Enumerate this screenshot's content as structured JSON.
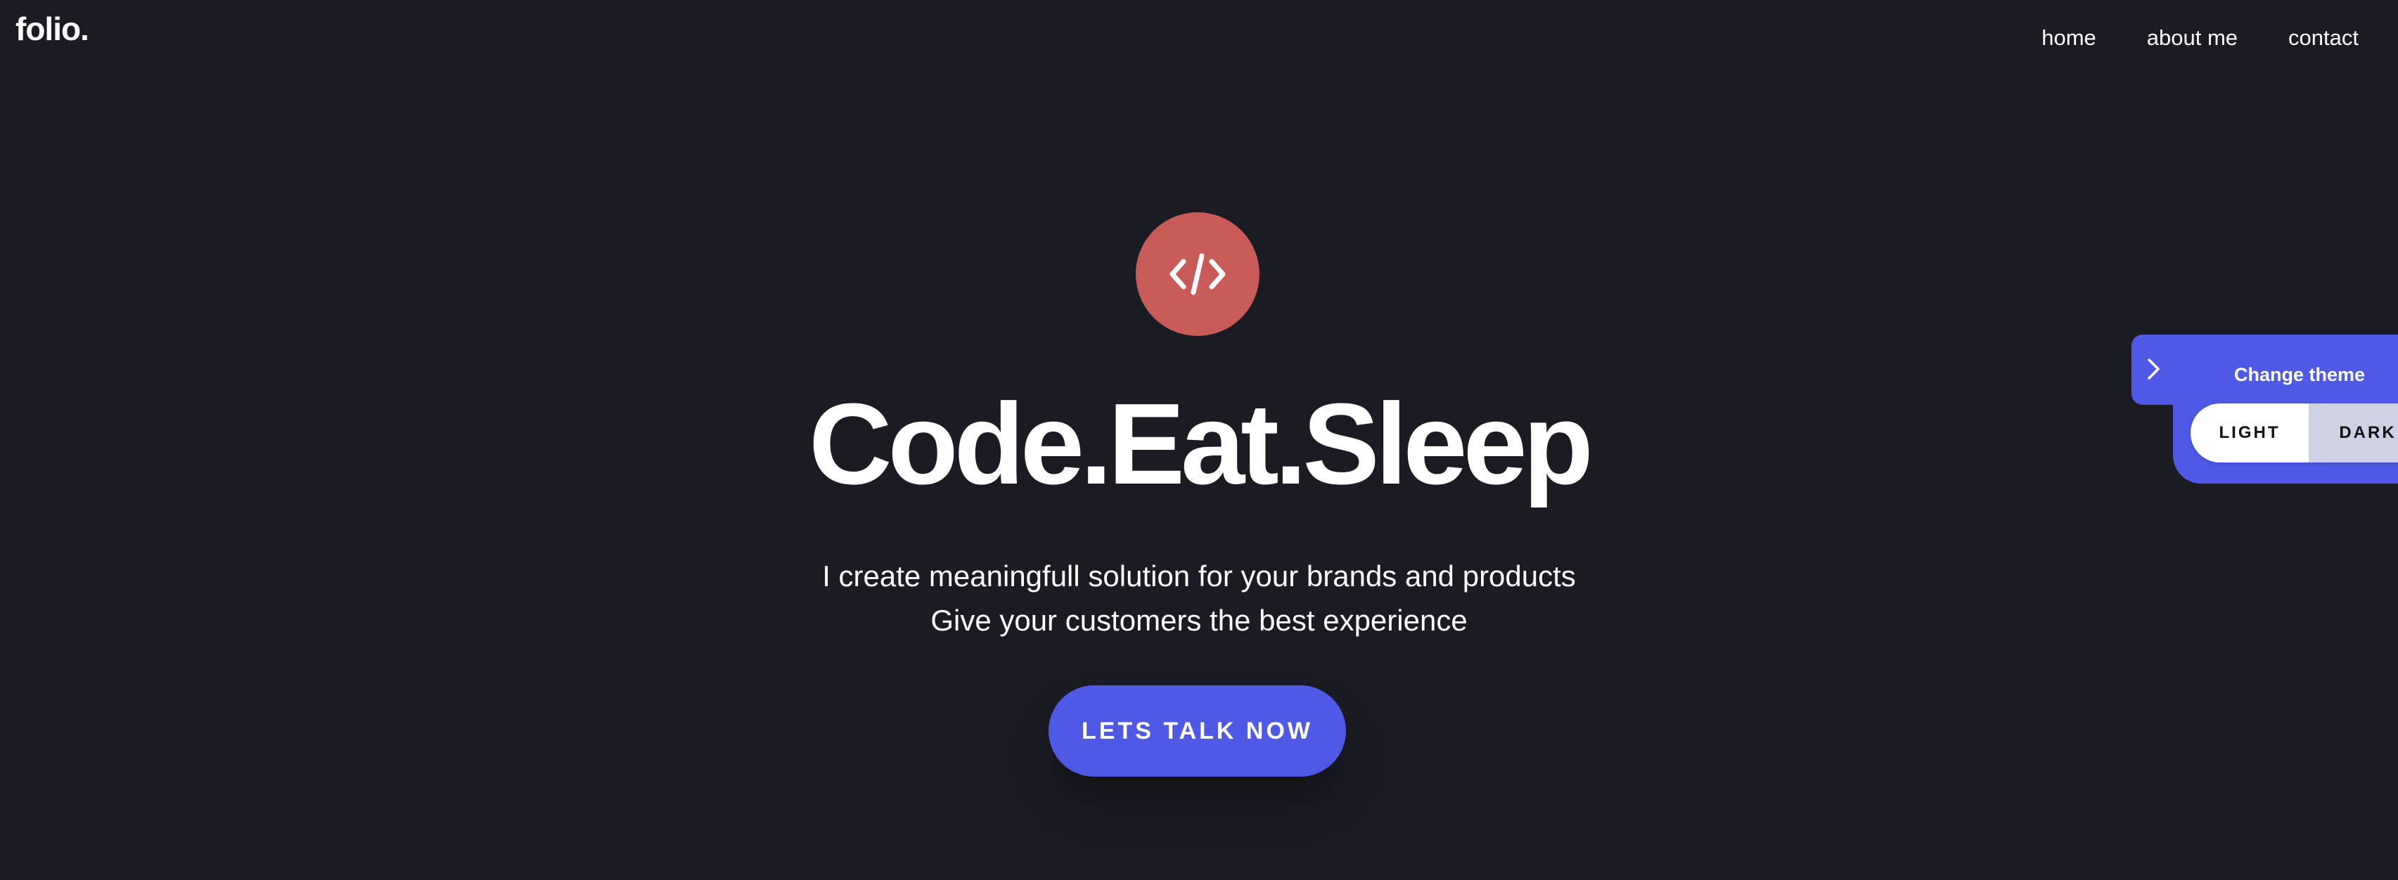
{
  "brand": {
    "logo": "folio."
  },
  "nav": {
    "items": [
      {
        "label": "home"
      },
      {
        "label": "about me"
      },
      {
        "label": "contact"
      }
    ]
  },
  "hero": {
    "icon": "code-icon",
    "title": "Code.Eat.Sleep",
    "subtitle_line1": "I create meaningfull solution for your brands and products",
    "subtitle_line2": "Give your customers the best experience",
    "cta_label": "LETS TALK NOW"
  },
  "theme_panel": {
    "label": "Change theme",
    "toggle_icon": "chevron-right-icon",
    "options": [
      {
        "label": "LIGHT"
      },
      {
        "label": "DARK"
      }
    ]
  },
  "colors": {
    "background": "#1a1b23",
    "accent": "#4e5ae6",
    "icon_circle": "#c85a58",
    "text": "#ffffff"
  }
}
